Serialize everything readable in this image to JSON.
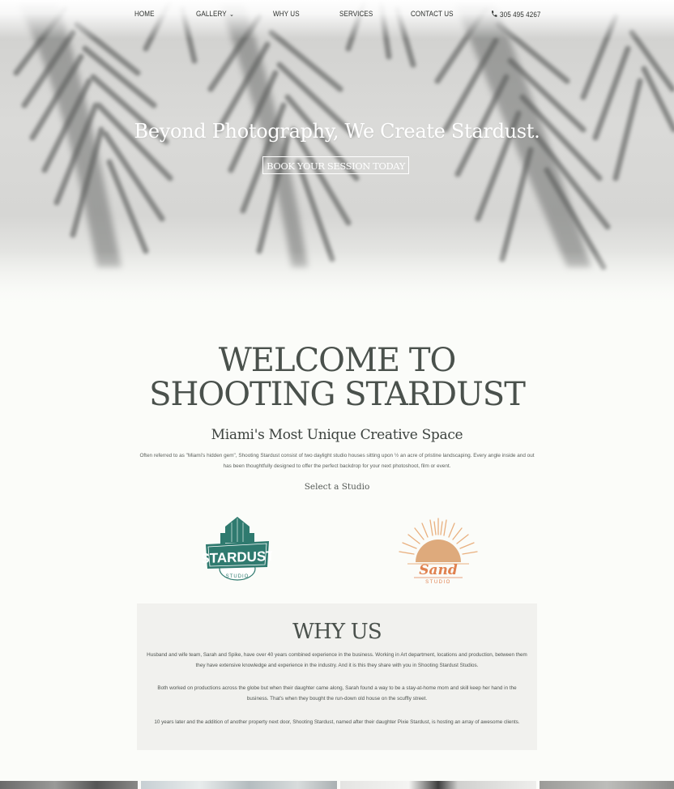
{
  "nav": {
    "home": "HOME",
    "gallery": "GALLERY",
    "why_us": "WHY US",
    "services": "SERVICES",
    "contact": "CONTACT US",
    "phone": "305 495 4267"
  },
  "hero": {
    "title": "Beyond Photography, We Create Stardust.",
    "button": "BOOK YOUR SESSION TODAY"
  },
  "welcome": {
    "title_line1": "WELCOME TO",
    "title_line2": "SHOOTING STARDUST",
    "subtitle": "Miami's Most Unique Creative Space",
    "intro": "Often referred to as \"Miami's hidden gem\", Shooting Stardust consist of two daylight studio houses sitting upon ½ an acre of pristine landscaping. Every angle inside and out has been thoughtfully designed to offer the perfect backdrop for your next photoshoot, film or event.",
    "select_label": "Select a Studio"
  },
  "logos": {
    "stardust_name": "STARDUST",
    "stardust_sub": "STUDIO",
    "sand_name": "Sand",
    "sand_sub": "STUDIO"
  },
  "why": {
    "title": "WHY US",
    "p1": "Husband and wife team, Sarah and Spike, have over 40 years combined experience in the business. Working in Art department, locations and production, between them they have extensive knowledge and experience in the industry. And it is this they share with you in Shooting Stardust Studios.",
    "p2": "Both worked on productions across the globe but when their daughter came along, Sarah found a way to be a stay-at-home mom and skill keep her hand in the business. That's when they bought the run-down old house on the scuffly street.",
    "p3": "10 years later and the addition of another property next door, Shooting Stardust, named after their daughter Pixie Stardust, is hosting an array of awesome clients."
  },
  "colors": {
    "background": "#fbfcf9",
    "heading": "#4a514c",
    "stardust_teal": "#2f7a6f",
    "sand_orange": "#e59a6a",
    "why_box": "#f1f1ee"
  },
  "icons": {
    "phone": "phone-icon",
    "gallery_dropdown": "chevron-down-icon"
  }
}
